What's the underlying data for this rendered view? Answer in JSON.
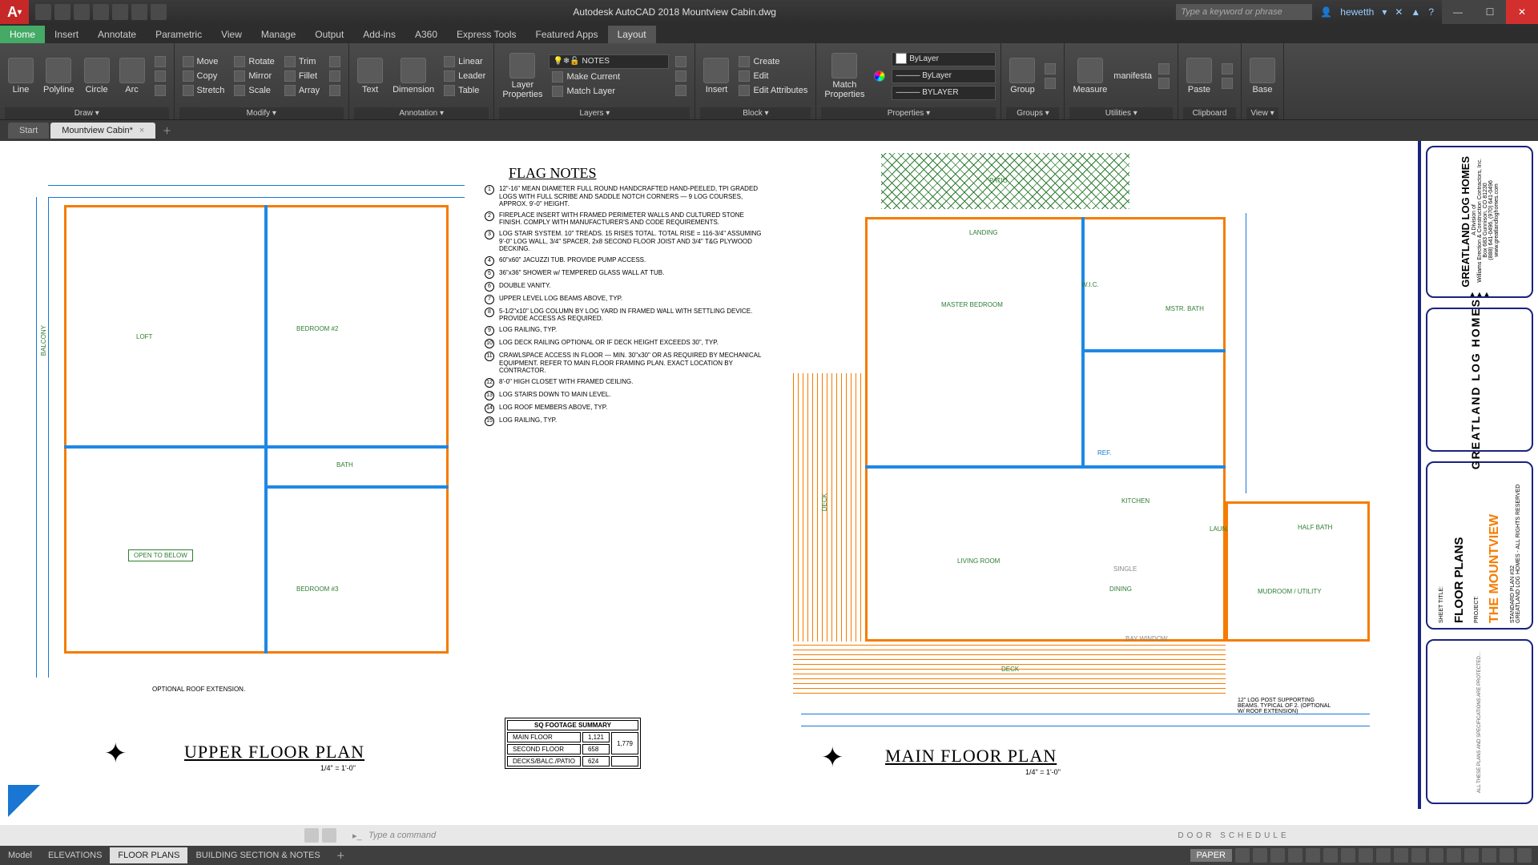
{
  "title": "Autodesk AutoCAD 2018   Mountview Cabin.dwg",
  "search_placeholder": "Type a keyword or phrase",
  "user": "hewetth",
  "menu_tabs": [
    "Home",
    "Insert",
    "Annotate",
    "Parametric",
    "View",
    "Manage",
    "Output",
    "Add-ins",
    "A360",
    "Express Tools",
    "Featured Apps",
    "Layout"
  ],
  "ribbon": {
    "draw": {
      "title": "Draw ▾",
      "line": "Line",
      "polyline": "Polyline",
      "circle": "Circle",
      "arc": "Arc"
    },
    "modify": {
      "title": "Modify ▾",
      "move": "Move",
      "copy": "Copy",
      "stretch": "Stretch",
      "rotate": "Rotate",
      "mirror": "Mirror",
      "scale": "Scale",
      "trim": "Trim",
      "fillet": "Fillet",
      "array": "Array"
    },
    "annotation": {
      "title": "Annotation ▾",
      "text": "Text",
      "dimension": "Dimension",
      "linear": "Linear",
      "leader": "Leader",
      "table": "Table"
    },
    "layers": {
      "title": "Layers ▾",
      "layer_properties": "Layer\nProperties",
      "current": "NOTES",
      "make_current": "Make Current",
      "match": "Match Layer"
    },
    "block": {
      "title": "Block ▾",
      "insert": "Insert",
      "create": "Create",
      "edit": "Edit",
      "edit_attr": "Edit Attributes"
    },
    "properties": {
      "title": "Properties ▾",
      "match": "Match\nProperties",
      "color": "ByLayer",
      "linetype": "ByLayer",
      "lineweight": "BYLAYER"
    },
    "groups": {
      "title": "Groups ▾",
      "group": "Group"
    },
    "utilities": {
      "title": "Utilities ▾",
      "measure": "Measure"
    },
    "clipboard": {
      "title": "Clipboard",
      "paste": "Paste"
    },
    "view": {
      "title": "View ▾",
      "base": "Base"
    }
  },
  "file_tabs": {
    "start": "Start",
    "active": "Mountview Cabin*"
  },
  "drawing": {
    "upper_title": "UPPER FLOOR PLAN",
    "main_title": "MAIN FLOOR PLAN",
    "scale": "1/4\" = 1'-0\"",
    "flag_notes_title": "FLAG NOTES",
    "flag_notes": [
      "12\"-16\" MEAN DIAMETER FULL ROUND HANDCRAFTED HAND-PEELED, TPI GRADED LOGS WITH FULL SCRIBE AND SADDLE NOTCH CORNERS — 9 LOG COURSES, APPROX. 9'-0\" HEIGHT.",
      "FIREPLACE INSERT WITH FRAMED PERIMETER WALLS AND CULTURED STONE FINISH. COMPLY WITH MANUFACTURER'S AND CODE REQUIREMENTS.",
      "LOG STAIR SYSTEM. 10\" TREADS. 15 RISES TOTAL. TOTAL RISE = 116-3/4\" ASSUMING 9'-0\" LOG WALL, 3/4\" SPACER, 2x8 SECOND FLOOR JOIST AND 3/4\" T&G PLYWOOD DECKING.",
      "60\"x60\" JACUZZI TUB. PROVIDE PUMP ACCESS.",
      "36\"x36\" SHOWER w/ TEMPERED GLASS WALL AT TUB.",
      "DOUBLE VANITY.",
      "UPPER LEVEL LOG BEAMS ABOVE, TYP.",
      "5-1/2\"x10\" LOG COLUMN BY LOG YARD IN FRAMED WALL WITH SETTLING DEVICE. PROVIDE ACCESS AS REQUIRED.",
      "LOG RAILING, TYP.",
      "LOG DECK RAILING OPTIONAL OR IF DECK HEIGHT EXCEEDS 30\", TYP.",
      "CRAWLSPACE ACCESS IN FLOOR — MIN. 30\"x30\" OR AS REQUIRED BY MECHANICAL EQUIPMENT. REFER TO MAIN FLOOR FRAMING PLAN. EXACT LOCATION BY CONTRACTOR.",
      "8'-0\" HIGH CLOSET WITH FRAMED CEILING.",
      "LOG STAIRS DOWN TO MAIN LEVEL.",
      "LOG ROOF MEMBERS ABOVE, TYP.",
      "LOG RAILING, TYP."
    ],
    "optional_roof": "OPTIONAL ROOF EXTENSION.",
    "rooms_upper": {
      "loft": "LOFT",
      "bed2": "BEDROOM #2",
      "bath": "BATH",
      "bed3": "BEDROOM #3",
      "open_below": "OPEN TO BELOW",
      "balcony": "BALCONY"
    },
    "rooms_main": {
      "master": "MASTER BEDROOM",
      "mbath": "MSTR. BATH",
      "wic": "W.I.C.",
      "kitchen": "KITCHEN",
      "living": "LIVING ROOM",
      "dining": "DINING",
      "laun": "LAUN.",
      "half": "HALF BATH",
      "mud": "MUDROOM / UTILITY",
      "landing": "LANDING",
      "deck": "DECK",
      "patio": "PATIO",
      "ref": "REF.",
      "bay": "BAY WINDOW",
      "single": "SINGLE"
    },
    "log_post_note": "12\" LOG POST SUPPORTING BEAMS. TYPICAL OF 2. (OPTIONAL W/ ROOF EXTENSION)",
    "sqft": {
      "title": "SQ FOOTAGE SUMMARY",
      "rows": [
        {
          "label": "MAIN FLOOR",
          "val": "1,121"
        },
        {
          "label": "SECOND FLOOR",
          "val": "658"
        },
        {
          "label": "DECKS/BALC./PATIO",
          "val": "624"
        }
      ],
      "total": "1,779"
    },
    "door_schedule": "DOOR SCHEDULE",
    "title_block": {
      "company": "GREATLAND LOG HOMES",
      "company_sub": "A Division of\nWilliams Erection & Construction Contractors, Inc.\nBox 683 Gunnison, CO 81230\n(888) 641-0496, (970) 641-0496\nwww.greatlandloghomes.com",
      "logo": "GREATLAND LOG HOMES",
      "sheet_title_label": "SHEET TITLE:",
      "sheet_title": "FLOOR PLANS",
      "project_label": "PROJECT:",
      "project": "THE MOUNTVIEW",
      "plan_no": "STANDARD PLAN #32",
      "rights": "GREATLAND LOG HOMES - ALL RIGHTS RESERVED"
    }
  },
  "command": {
    "placeholder": "Type a command",
    "right": "DOOR SCHEDULE"
  },
  "layout_tabs": [
    "Model",
    "ELEVATIONS",
    "FLOOR PLANS",
    "BUILDING SECTION & NOTES"
  ],
  "status": {
    "paper": "PAPER"
  }
}
